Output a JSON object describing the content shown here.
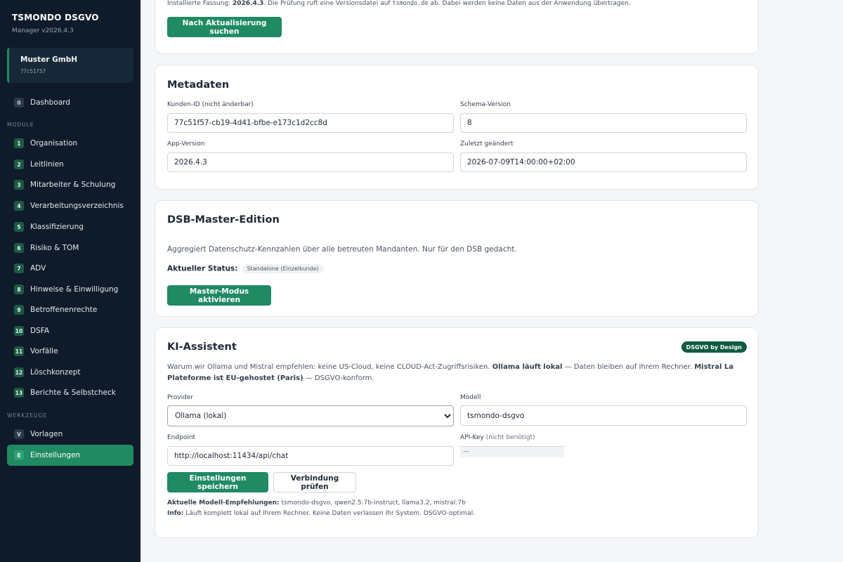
{
  "sidebar": {
    "app_title": "TSMONDO DSGVO",
    "app_version": "Manager v2026.4.3",
    "tenant_name": "Muster GmbH",
    "tenant_id": "77c51f57",
    "dashboard": {
      "badge": "0",
      "label": "Dashboard"
    },
    "modules_label": "MODULE",
    "modules": [
      {
        "badge": "1",
        "label": "Organisation"
      },
      {
        "badge": "2",
        "label": "Leitlinien"
      },
      {
        "badge": "3",
        "label": "Mitarbeiter & Schulung"
      },
      {
        "badge": "4",
        "label": "Verarbeitungsverzeichnis"
      },
      {
        "badge": "5",
        "label": "Klassifizierung"
      },
      {
        "badge": "6",
        "label": "Risiko & TOM"
      },
      {
        "badge": "7",
        "label": "ADV"
      },
      {
        "badge": "8",
        "label": "Hinweise & Einwilligung"
      },
      {
        "badge": "9",
        "label": "Betroffenenrechte"
      },
      {
        "badge": "10",
        "label": "DSFA"
      },
      {
        "badge": "11",
        "label": "Vorfälle"
      },
      {
        "badge": "12",
        "label": "Löschkonzept"
      },
      {
        "badge": "13",
        "label": "Berichte & Selbstcheck"
      }
    ],
    "tools_label": "WERKZEUGE",
    "tools": [
      {
        "badge": "V",
        "label": "Vorlagen"
      },
      {
        "badge": "E",
        "label": "Einstellungen",
        "active": true
      }
    ]
  },
  "update": {
    "prefix": "Installierte Fassung: ",
    "version": "2026.4.3",
    "mid": ". Die Prüfung ruft eine Versionsdatei auf ",
    "domain": "tsmondo.de",
    "suffix": " ab. Dabei werden keine Daten aus der Anwendung übertragen.",
    "button": "Nach Aktualisierung suchen"
  },
  "metadata": {
    "title": "Metadaten",
    "customer_id_label": "Kunden-ID (nicht änderbar)",
    "customer_id_value": "77c51f57-cb19-4d41-bfbe-e173c1d2cc8d",
    "schema_label": "Schema-Version",
    "schema_value": "8",
    "app_version_label": "App-Version",
    "app_version_value": "2026.4.3",
    "modified_label": "Zuletzt geändert",
    "modified_value": "2026-07-09T14:00:00+02:00"
  },
  "dsb": {
    "title": "DSB-Master-Edition",
    "description": "Aggregiert Datenschutz-Kennzahlen über alle betreuten Mandanten. Nur für den DSB gedacht.",
    "status_label": "Aktueller Status:",
    "status_value": "Standalone (Einzelkunde)",
    "button": "Master-Modus aktivieren"
  },
  "ki": {
    "title": "KI-Assistent",
    "badge": "DSGVO by Design",
    "desc_part1": "Warum wir Ollama und Mistral empfehlen: keine US-Cloud, keine CLOUD-Act-Zugriffsrisiken. ",
    "desc_bold1": "Ollama läuft lokal",
    "desc_part2": " — Daten bleiben auf Ihrem Rechner. ",
    "desc_bold2": "Mistral La Plateforme ist EU-gehostet (Paris)",
    "desc_part3": " — DSGVO-konform.",
    "provider_label": "Provider",
    "provider_value": "Ollama (lokal)",
    "model_label": "Modell",
    "model_value": "tsmondo-dsgvo",
    "endpoint_label": "Endpoint",
    "endpoint_value": "http://localhost:11434/api/chat",
    "apikey_label": "API-Key",
    "apikey_hint": "(nicht benötigt)",
    "apikey_value": "—",
    "save_button": "Einstellungen speichern",
    "test_button": "Verbindung prüfen",
    "recommend_label": "Aktuelle Modell-Empfehlungen:",
    "recommend_value": " tsmondo-dsgvo, qwen2.5:7b-instruct, llama3.2, mistral:7b",
    "info_label": "Info:",
    "info_value": " Läuft komplett lokal auf Ihrem Rechner. Keine Daten verlassen Ihr System. DSGVO-optimal."
  }
}
